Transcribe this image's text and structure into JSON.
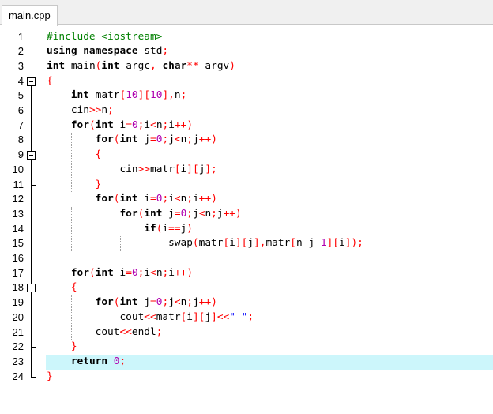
{
  "tab": {
    "label": "main.cpp"
  },
  "highlighted_line": 23,
  "line_numbers": [
    "1",
    "2",
    "3",
    "4",
    "5",
    "6",
    "7",
    "8",
    "9",
    "10",
    "11",
    "12",
    "13",
    "14",
    "15",
    "16",
    "17",
    "18",
    "19",
    "20",
    "21",
    "22",
    "23",
    "24"
  ],
  "lines": [
    [
      {
        "t": "#include <iostream>",
        "c": "pp"
      }
    ],
    [
      {
        "t": "using namespace",
        "c": "kw"
      },
      {
        "t": " std",
        "c": ""
      },
      {
        "t": ";",
        "c": "op"
      }
    ],
    [
      {
        "t": "int",
        "c": "kw"
      },
      {
        "t": " main",
        "c": ""
      },
      {
        "t": "(",
        "c": "op"
      },
      {
        "t": "int",
        "c": "kw"
      },
      {
        "t": " argc",
        "c": ""
      },
      {
        "t": ",",
        "c": "op"
      },
      {
        "t": " ",
        "c": ""
      },
      {
        "t": "char",
        "c": "kw"
      },
      {
        "t": "**",
        "c": "op"
      },
      {
        "t": " argv",
        "c": ""
      },
      {
        "t": ")",
        "c": "op"
      }
    ],
    [
      {
        "t": "{",
        "c": "op"
      }
    ],
    [
      {
        "t": "    ",
        "c": ""
      },
      {
        "t": "int",
        "c": "kw"
      },
      {
        "t": " matr",
        "c": ""
      },
      {
        "t": "[",
        "c": "op"
      },
      {
        "t": "10",
        "c": "num"
      },
      {
        "t": "][",
        "c": "op"
      },
      {
        "t": "10",
        "c": "num"
      },
      {
        "t": "],",
        "c": "op"
      },
      {
        "t": "n",
        "c": ""
      },
      {
        "t": ";",
        "c": "op"
      }
    ],
    [
      {
        "t": "    cin",
        "c": ""
      },
      {
        "t": ">>",
        "c": "op"
      },
      {
        "t": "n",
        "c": ""
      },
      {
        "t": ";",
        "c": "op"
      }
    ],
    [
      {
        "t": "    ",
        "c": ""
      },
      {
        "t": "for",
        "c": "kw"
      },
      {
        "t": "(",
        "c": "op"
      },
      {
        "t": "int",
        "c": "kw"
      },
      {
        "t": " i",
        "c": ""
      },
      {
        "t": "=",
        "c": "op"
      },
      {
        "t": "0",
        "c": "num"
      },
      {
        "t": ";",
        "c": "op"
      },
      {
        "t": "i",
        "c": ""
      },
      {
        "t": "<",
        "c": "op"
      },
      {
        "t": "n",
        "c": ""
      },
      {
        "t": ";",
        "c": "op"
      },
      {
        "t": "i",
        "c": ""
      },
      {
        "t": "++)",
        "c": "op"
      }
    ],
    [
      {
        "t": "        ",
        "c": ""
      },
      {
        "t": "for",
        "c": "kw"
      },
      {
        "t": "(",
        "c": "op"
      },
      {
        "t": "int",
        "c": "kw"
      },
      {
        "t": " j",
        "c": ""
      },
      {
        "t": "=",
        "c": "op"
      },
      {
        "t": "0",
        "c": "num"
      },
      {
        "t": ";",
        "c": "op"
      },
      {
        "t": "j",
        "c": ""
      },
      {
        "t": "<",
        "c": "op"
      },
      {
        "t": "n",
        "c": ""
      },
      {
        "t": ";",
        "c": "op"
      },
      {
        "t": "j",
        "c": ""
      },
      {
        "t": "++)",
        "c": "op"
      }
    ],
    [
      {
        "t": "        ",
        "c": ""
      },
      {
        "t": "{",
        "c": "op"
      }
    ],
    [
      {
        "t": "            cin",
        "c": ""
      },
      {
        "t": ">>",
        "c": "op"
      },
      {
        "t": "matr",
        "c": ""
      },
      {
        "t": "[",
        "c": "op"
      },
      {
        "t": "i",
        "c": ""
      },
      {
        "t": "][",
        "c": "op"
      },
      {
        "t": "j",
        "c": ""
      },
      {
        "t": "];",
        "c": "op"
      }
    ],
    [
      {
        "t": "        ",
        "c": ""
      },
      {
        "t": "}",
        "c": "op"
      }
    ],
    [
      {
        "t": "        ",
        "c": ""
      },
      {
        "t": "for",
        "c": "kw"
      },
      {
        "t": "(",
        "c": "op"
      },
      {
        "t": "int",
        "c": "kw"
      },
      {
        "t": " i",
        "c": ""
      },
      {
        "t": "=",
        "c": "op"
      },
      {
        "t": "0",
        "c": "num"
      },
      {
        "t": ";",
        "c": "op"
      },
      {
        "t": "i",
        "c": ""
      },
      {
        "t": "<",
        "c": "op"
      },
      {
        "t": "n",
        "c": ""
      },
      {
        "t": ";",
        "c": "op"
      },
      {
        "t": "i",
        "c": ""
      },
      {
        "t": "++)",
        "c": "op"
      }
    ],
    [
      {
        "t": "            ",
        "c": ""
      },
      {
        "t": "for",
        "c": "kw"
      },
      {
        "t": "(",
        "c": "op"
      },
      {
        "t": "int",
        "c": "kw"
      },
      {
        "t": " j",
        "c": ""
      },
      {
        "t": "=",
        "c": "op"
      },
      {
        "t": "0",
        "c": "num"
      },
      {
        "t": ";",
        "c": "op"
      },
      {
        "t": "j",
        "c": ""
      },
      {
        "t": "<",
        "c": "op"
      },
      {
        "t": "n",
        "c": ""
      },
      {
        "t": ";",
        "c": "op"
      },
      {
        "t": "j",
        "c": ""
      },
      {
        "t": "++)",
        "c": "op"
      }
    ],
    [
      {
        "t": "                ",
        "c": ""
      },
      {
        "t": "if",
        "c": "kw"
      },
      {
        "t": "(",
        "c": "op"
      },
      {
        "t": "i",
        "c": ""
      },
      {
        "t": "==",
        "c": "op"
      },
      {
        "t": "j",
        "c": ""
      },
      {
        "t": ")",
        "c": "op"
      }
    ],
    [
      {
        "t": "                    swap",
        "c": ""
      },
      {
        "t": "(",
        "c": "op"
      },
      {
        "t": "matr",
        "c": ""
      },
      {
        "t": "[",
        "c": "op"
      },
      {
        "t": "i",
        "c": ""
      },
      {
        "t": "][",
        "c": "op"
      },
      {
        "t": "j",
        "c": ""
      },
      {
        "t": "],",
        "c": "op"
      },
      {
        "t": "matr",
        "c": ""
      },
      {
        "t": "[",
        "c": "op"
      },
      {
        "t": "n",
        "c": ""
      },
      {
        "t": "-",
        "c": "op"
      },
      {
        "t": "j",
        "c": ""
      },
      {
        "t": "-",
        "c": "op"
      },
      {
        "t": "1",
        "c": "num"
      },
      {
        "t": "][",
        "c": "op"
      },
      {
        "t": "i",
        "c": ""
      },
      {
        "t": "]);",
        "c": "op"
      }
    ],
    [],
    [
      {
        "t": "    ",
        "c": ""
      },
      {
        "t": "for",
        "c": "kw"
      },
      {
        "t": "(",
        "c": "op"
      },
      {
        "t": "int",
        "c": "kw"
      },
      {
        "t": " i",
        "c": ""
      },
      {
        "t": "=",
        "c": "op"
      },
      {
        "t": "0",
        "c": "num"
      },
      {
        "t": ";",
        "c": "op"
      },
      {
        "t": "i",
        "c": ""
      },
      {
        "t": "<",
        "c": "op"
      },
      {
        "t": "n",
        "c": ""
      },
      {
        "t": ";",
        "c": "op"
      },
      {
        "t": "i",
        "c": ""
      },
      {
        "t": "++)",
        "c": "op"
      }
    ],
    [
      {
        "t": "    ",
        "c": ""
      },
      {
        "t": "{",
        "c": "op"
      }
    ],
    [
      {
        "t": "        ",
        "c": ""
      },
      {
        "t": "for",
        "c": "kw"
      },
      {
        "t": "(",
        "c": "op"
      },
      {
        "t": "int",
        "c": "kw"
      },
      {
        "t": " j",
        "c": ""
      },
      {
        "t": "=",
        "c": "op"
      },
      {
        "t": "0",
        "c": "num"
      },
      {
        "t": ";",
        "c": "op"
      },
      {
        "t": "j",
        "c": ""
      },
      {
        "t": "<",
        "c": "op"
      },
      {
        "t": "n",
        "c": ""
      },
      {
        "t": ";",
        "c": "op"
      },
      {
        "t": "j",
        "c": ""
      },
      {
        "t": "++)",
        "c": "op"
      }
    ],
    [
      {
        "t": "            cout",
        "c": ""
      },
      {
        "t": "<<",
        "c": "op"
      },
      {
        "t": "matr",
        "c": ""
      },
      {
        "t": "[",
        "c": "op"
      },
      {
        "t": "i",
        "c": ""
      },
      {
        "t": "][",
        "c": "op"
      },
      {
        "t": "j",
        "c": ""
      },
      {
        "t": "]<<",
        "c": "op"
      },
      {
        "t": "\" \"",
        "c": "st"
      },
      {
        "t": ";",
        "c": "op"
      }
    ],
    [
      {
        "t": "        cout",
        "c": ""
      },
      {
        "t": "<<",
        "c": "op"
      },
      {
        "t": "endl",
        "c": ""
      },
      {
        "t": ";",
        "c": "op"
      }
    ],
    [
      {
        "t": "    ",
        "c": ""
      },
      {
        "t": "}",
        "c": "op"
      }
    ],
    [
      {
        "t": "    ",
        "c": ""
      },
      {
        "t": "return",
        "c": "kw"
      },
      {
        "t": " ",
        "c": ""
      },
      {
        "t": "0",
        "c": "num"
      },
      {
        "t": ";",
        "c": "op"
      }
    ],
    [
      {
        "t": "}",
        "c": "op"
      }
    ]
  ],
  "folds": [
    {
      "start": 4,
      "end": 24
    },
    {
      "start": 9,
      "end": 11
    },
    {
      "start": 18,
      "end": 22
    }
  ],
  "guides": [
    {
      "col": 4,
      "from": 8,
      "to": 11
    },
    {
      "col": 4,
      "from": 13,
      "to": 15
    },
    {
      "col": 8,
      "from": 10,
      "to": 10
    },
    {
      "col": 8,
      "from": 14,
      "to": 15
    },
    {
      "col": 12,
      "from": 15,
      "to": 15
    },
    {
      "col": 4,
      "from": 19,
      "to": 21
    },
    {
      "col": 8,
      "from": 20,
      "to": 20
    }
  ]
}
